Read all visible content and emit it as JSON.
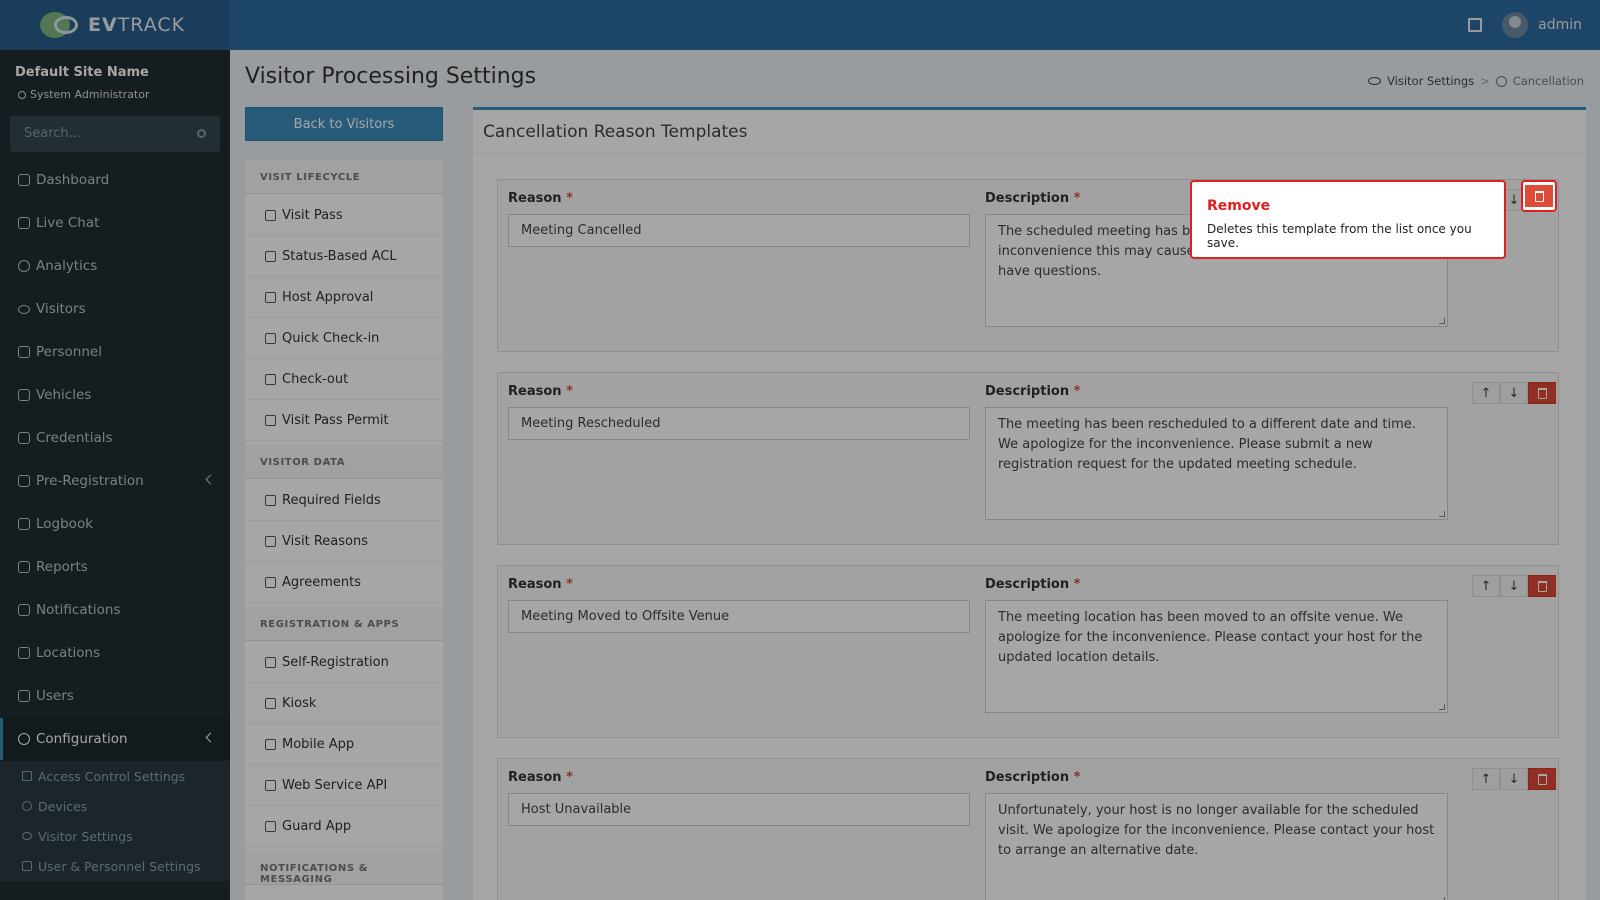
{
  "brand": {
    "logo_bold": "EV",
    "logo_rest": "TRACK"
  },
  "topbar": {
    "user": "admin"
  },
  "sidebar": {
    "site_name": "Default Site Name",
    "role": "System Administrator",
    "search_placeholder": "Search...",
    "items": [
      {
        "label": "Dashboard"
      },
      {
        "label": "Live Chat"
      },
      {
        "label": "Analytics"
      },
      {
        "label": "Visitors"
      },
      {
        "label": "Personnel"
      },
      {
        "label": "Vehicles"
      },
      {
        "label": "Credentials"
      },
      {
        "label": "Pre-Registration"
      },
      {
        "label": "Logbook"
      },
      {
        "label": "Reports"
      },
      {
        "label": "Notifications"
      },
      {
        "label": "Locations"
      },
      {
        "label": "Users"
      },
      {
        "label": "Configuration"
      }
    ],
    "sub_items": [
      {
        "label": "Access Control Settings"
      },
      {
        "label": "Devices"
      },
      {
        "label": "Visitor Settings"
      },
      {
        "label": "User & Personnel Settings"
      }
    ]
  },
  "page": {
    "title": "Visitor Processing Settings",
    "breadcrumb": {
      "parent": "Visitor Settings",
      "sep": ">",
      "current": "Cancellation"
    },
    "back_button": "Back to Visitors"
  },
  "subnav": {
    "sections": [
      {
        "heading": "VISIT LIFECYCLE",
        "items": [
          "Visit Pass",
          "Status-Based ACL",
          "Host Approval",
          "Quick Check-in",
          "Check-out",
          "Visit Pass Permit"
        ]
      },
      {
        "heading": "VISITOR DATA",
        "items": [
          "Required Fields",
          "Visit Reasons",
          "Agreements"
        ]
      },
      {
        "heading": "REGISTRATION & APPS",
        "items": [
          "Self-Registration",
          "Kiosk",
          "Mobile App",
          "Web Service API",
          "Guard App"
        ]
      },
      {
        "heading": "NOTIFICATIONS & MESSAGING",
        "items": []
      }
    ]
  },
  "card": {
    "title": "Cancellation Reason Templates",
    "reason_label": "Reason",
    "description_label": "Description",
    "required_mark": "*",
    "up_glyph": "↑",
    "down_glyph": "↓",
    "templates": [
      {
        "reason": "Meeting Cancelled",
        "description": "The scheduled meeting has been cancelled. We apologize for any inconvenience this may cause. Please contact your host if you have questions."
      },
      {
        "reason": "Meeting Rescheduled",
        "description": "The meeting has been rescheduled to a different date and time. We apologize for the inconvenience. Please submit a new registration request for the updated meeting schedule."
      },
      {
        "reason": "Meeting Moved to Offsite Venue",
        "description": "The meeting location has been moved to an offsite venue. We apologize for the inconvenience. Please contact your host for the updated location details."
      },
      {
        "reason": "Host Unavailable",
        "description": "Unfortunately, your host is no longer available for the scheduled visit. We apologize for the inconvenience. Please contact your host to arrange an alternative date."
      }
    ]
  },
  "tooltip": {
    "title": "Remove",
    "body": "Deletes this template from the list once you save."
  }
}
